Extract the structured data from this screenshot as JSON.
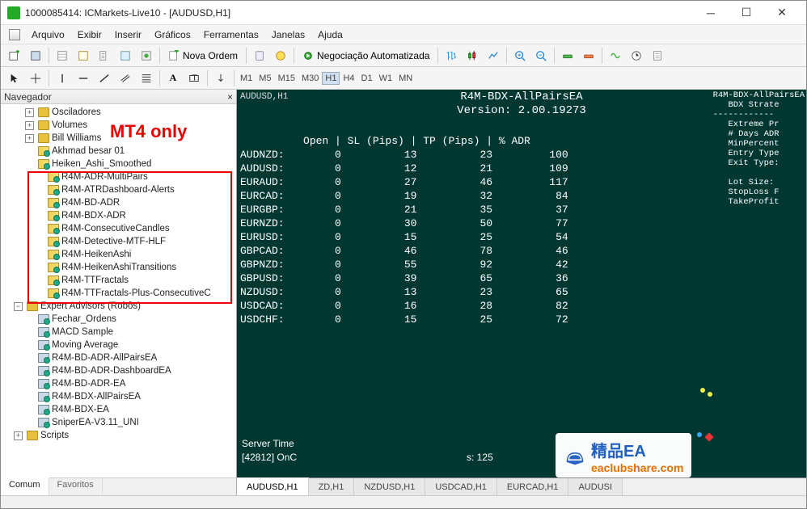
{
  "window": {
    "title": "1000085414: ICMarkets-Live10 - [AUDUSD,H1]"
  },
  "menu": {
    "items": [
      "Arquivo",
      "Exibir",
      "Inserir",
      "Gráficos",
      "Ferramentas",
      "Janelas",
      "Ajuda"
    ]
  },
  "toolbar": {
    "nova_ordem": "Nova Ordem",
    "negociacao": "Negociação Automatizada"
  },
  "timeframes": {
    "items": [
      "M1",
      "M5",
      "M15",
      "M30",
      "H1",
      "H4",
      "D1",
      "W1",
      "MN"
    ],
    "active": "H1"
  },
  "navigator": {
    "title": "Navegador",
    "annotation_label": "MT4 only",
    "groups": {
      "osciladores": "Osciladores",
      "volumes": "Volumes",
      "bill_williams": "Bill Williams",
      "akhmad": "Akhmad besar 01",
      "heiken_smoothed": "Heiken_Ashi_Smoothed",
      "expert_advisors": "Expert Advisors (Robôs)",
      "scripts": "Scripts"
    },
    "boxed_items": [
      "R4M-ADR-MultiPairs",
      "R4M-ATRDashboard-Alerts",
      "R4M-BD-ADR",
      "R4M-BDX-ADR",
      "R4M-ConsecutiveCandles",
      "R4M-Detective-MTF-HLF",
      "R4M-HeikenAshi",
      "R4M-HeikenAshiTransitions",
      "R4M-TTFractals",
      "R4M-TTFractals-Plus-ConsecutiveC"
    ],
    "ea_items": [
      "Fechar_Ordens",
      "MACD Sample",
      "Moving Average",
      "R4M-BD-ADR-AllPairsEA",
      "R4M-BD-ADR-DashboardEA",
      "R4M-BD-ADR-EA",
      "R4M-BDX-AllPairsEA",
      "R4M-BDX-EA",
      "SniperEA-V3.11_UNI"
    ],
    "tabs": {
      "comum": "Comum",
      "favoritos": "Favoritos"
    }
  },
  "chart": {
    "pair_label": "AUDUSD,H1",
    "ea_name": "R4M-BDX-AllPairsEA",
    "ea_version": "Version: 2.00.19273",
    "corner": "R4M-BDX-AllPairsEA\n   BDX Strate\n------------\n   Extreme Pr\n   # Days ADR\n   MinPercent\n   Entry Type\n   Exit Type:\n\n   Lot Size: \n   StopLoss F\n   TakeProfit",
    "header_row": "          Open | SL (Pips) | TP (Pips) | % ADR",
    "rows": [
      {
        "pair": "AUDNZD",
        "open": 0,
        "sl": 13,
        "tp": 23,
        "adr": 100
      },
      {
        "pair": "AUDUSD",
        "open": 0,
        "sl": 12,
        "tp": 21,
        "adr": 109
      },
      {
        "pair": "EURAUD",
        "open": 0,
        "sl": 27,
        "tp": 46,
        "adr": 117
      },
      {
        "pair": "EURCAD",
        "open": 0,
        "sl": 19,
        "tp": 32,
        "adr": 84
      },
      {
        "pair": "EURGBP",
        "open": 0,
        "sl": 21,
        "tp": 35,
        "adr": 37
      },
      {
        "pair": "EURNZD",
        "open": 0,
        "sl": 30,
        "tp": 50,
        "adr": 77
      },
      {
        "pair": "EURUSD",
        "open": 0,
        "sl": 15,
        "tp": 25,
        "adr": 54
      },
      {
        "pair": "GBPCAD",
        "open": 0,
        "sl": 46,
        "tp": 78,
        "adr": 46
      },
      {
        "pair": "GBPNZD",
        "open": 0,
        "sl": 55,
        "tp": 92,
        "adr": 42
      },
      {
        "pair": "GBPUSD",
        "open": 0,
        "sl": 39,
        "tp": 65,
        "adr": 36
      },
      {
        "pair": "NZDUSD",
        "open": 0,
        "sl": 13,
        "tp": 23,
        "adr": 65
      },
      {
        "pair": "USDCAD",
        "open": 0,
        "sl": 16,
        "tp": 28,
        "adr": 82
      },
      {
        "pair": "USDCHF",
        "open": 0,
        "sl": 15,
        "tp": 25,
        "adr": 72
      }
    ],
    "server_time": "Server Time",
    "oncalc": "[42812] OnC",
    "oncalc_tail": "s: 125",
    "tabs": [
      "AUDUSD,H1",
      "ZD,H1",
      "NZDUSD,H1",
      "USDCAD,H1",
      "EURCAD,H1",
      "AUDUSI"
    ]
  },
  "watermark": {
    "brand": "精品EA",
    "url": "eaclubshare.com"
  }
}
